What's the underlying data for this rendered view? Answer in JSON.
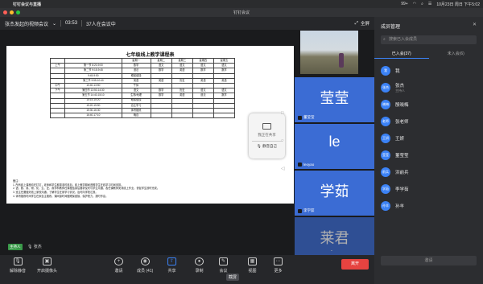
{
  "macbar": {
    "app": "钉钉会议",
    "menu": "钉钉会议与直播",
    "battery": "99+",
    "datetime": "10月23日 周日 下午5:02"
  },
  "window": {
    "title": "钉钉会议"
  },
  "meeting": {
    "name": "张杰发起的视频会议",
    "time": "03:53",
    "count": "37人在会议中",
    "fullscreen": "全屏"
  },
  "schedule": {
    "title": "七年级线上教学课程表",
    "header": [
      "",
      "",
      "星期一",
      "星期二",
      "星期三",
      "星期四",
      "星期五"
    ],
    "rows": [
      [
        "上午",
        "第一节 8:20-9:00",
        "数学",
        "语文",
        "语文",
        "语文",
        "语文"
      ],
      [
        "",
        "第二节 9:15-9:45",
        "道法",
        "数学",
        "英语",
        "数学",
        "数学"
      ],
      [
        "",
        "9:45-9:50",
        "眼保健操",
        "",
        "",
        "",
        ""
      ],
      [
        "",
        "第三节 9:55-10:40",
        "英语",
        "英语",
        "历史",
        "英语",
        "英语"
      ],
      [
        "中午",
        "10:40-13:50",
        "午休",
        "",
        "",
        "",
        ""
      ],
      [
        "下午",
        "第四节 13:50-14:30",
        "语文",
        "数学",
        "历史",
        "语文",
        "语文"
      ],
      [
        "",
        "第五节 14:40-15:10",
        "生物/地理",
        "数学",
        "英语",
        "道法",
        "数学"
      ],
      [
        "",
        "15:15-15:20",
        "眼保健操",
        "",
        "",
        "",
        ""
      ],
      [
        "",
        "15:20-15:50",
        "自主学习",
        "",
        "",
        "",
        ""
      ],
      [
        "",
        "15:30-16:30",
        "体育锻炼",
        "",
        "",
        "",
        ""
      ],
      [
        "",
        "16:40-17:10",
        "晚自",
        "",
        "",
        "",
        ""
      ]
    ],
    "notes": [
      "备注：",
      "1. 所有线上课程均在钉钉，老师和学生都需准时参加，线上教学期间遵照学生在线学习时间安排。",
      "2. 语、数、英、物、化、生、史、政学科教师在课程结束后要求及时与学生沟通，各任课教师安排线上作业，督促学生按时完成。",
      "3. 班主任要做好线上家校沟通，了解学生在家学习情况，及时向学校汇报。",
      "4. 体育锻炼时间学生在家自主锻炼，课间操时间做眼保健操，保护视力，按时作息。"
    ]
  },
  "share": {
    "stopping": "我正在共享",
    "mute_self": "静音自己"
  },
  "tiles": [
    {
      "big": "莹莹",
      "name": "董莹莹"
    },
    {
      "big": "le",
      "name": "leoyao"
    },
    {
      "big": "学茹",
      "name": "李学茹"
    },
    {
      "big": "莱君",
      "name": ""
    }
  ],
  "host": {
    "tag": "主持人",
    "name": "张杰"
  },
  "panel": {
    "title": "成员管理",
    "search_placeholder": "搜索已入会成员",
    "tab_joined": "已入会(37)",
    "tab_not_joined": "未入会(6)",
    "members": [
      {
        "avatar": "我",
        "name": "我",
        "sub": ""
      },
      {
        "avatar": "张杰",
        "name": "张杰",
        "sub": "主持人"
      },
      {
        "avatar": "晓梅",
        "name": "殷晓梅",
        "sub": ""
      },
      {
        "avatar": "老师",
        "name": "张老师",
        "sub": ""
      },
      {
        "avatar": "王妍",
        "name": "王妍",
        "sub": ""
      },
      {
        "avatar": "莹莹",
        "name": "董莹莹",
        "sub": ""
      },
      {
        "avatar": "前兵",
        "name": "洪前兵",
        "sub": ""
      },
      {
        "avatar": "学茹",
        "name": "李学茹",
        "sub": ""
      },
      {
        "avatar": "孙羊",
        "name": "孙羊",
        "sub": ""
      }
    ],
    "invite": "邀请"
  },
  "toolbar": {
    "unmute": "解除静音",
    "camera": "开启摄像头",
    "invite": "邀请",
    "members": "成员 (41)",
    "share": "共享",
    "record": "录制",
    "minutes": "会议",
    "view": "视图",
    "more": "更多",
    "leave": "离开",
    "screenshot_badge": "截屏"
  }
}
